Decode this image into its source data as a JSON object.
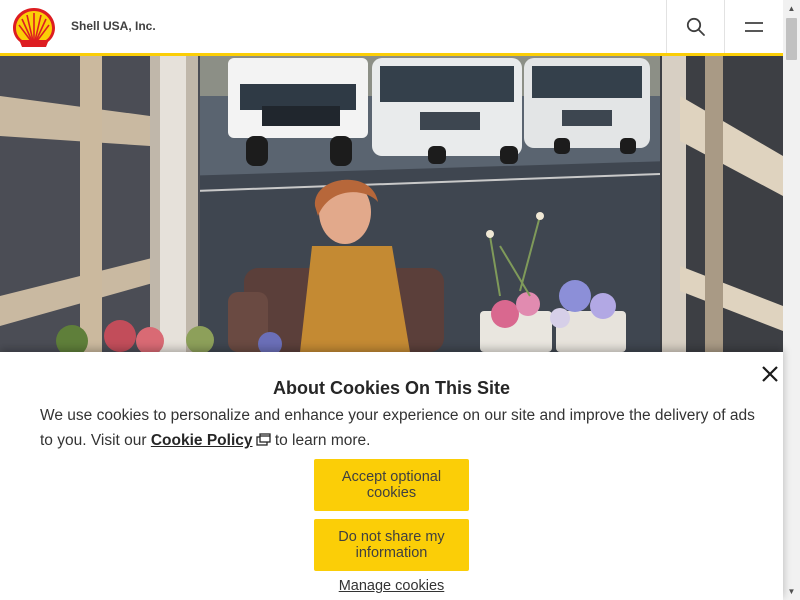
{
  "header": {
    "company_name": "Shell USA, Inc.",
    "logo_icon": "shell-pecten-logo",
    "search_icon": "search-icon",
    "menu_icon": "hamburger-menu-icon",
    "accent_color": "#fbce07",
    "brand_red": "#dd1d21"
  },
  "hero": {
    "description_icon": "hero-photo"
  },
  "cookie_banner": {
    "title": "About Cookies On This Site",
    "text_before_link": "We use cookies to personalize and enhance your experience on our site and improve the delivery of ads to you. Visit our ",
    "link_label": "Cookie Policy",
    "text_after_link": " to learn more.",
    "accept_button": "Accept optional cookies",
    "deny_button": "Do not share my information",
    "manage_link": "Manage cookies",
    "close_icon": "close-icon",
    "external_icon": "external-link-icon",
    "button_color": "#fbce07"
  }
}
